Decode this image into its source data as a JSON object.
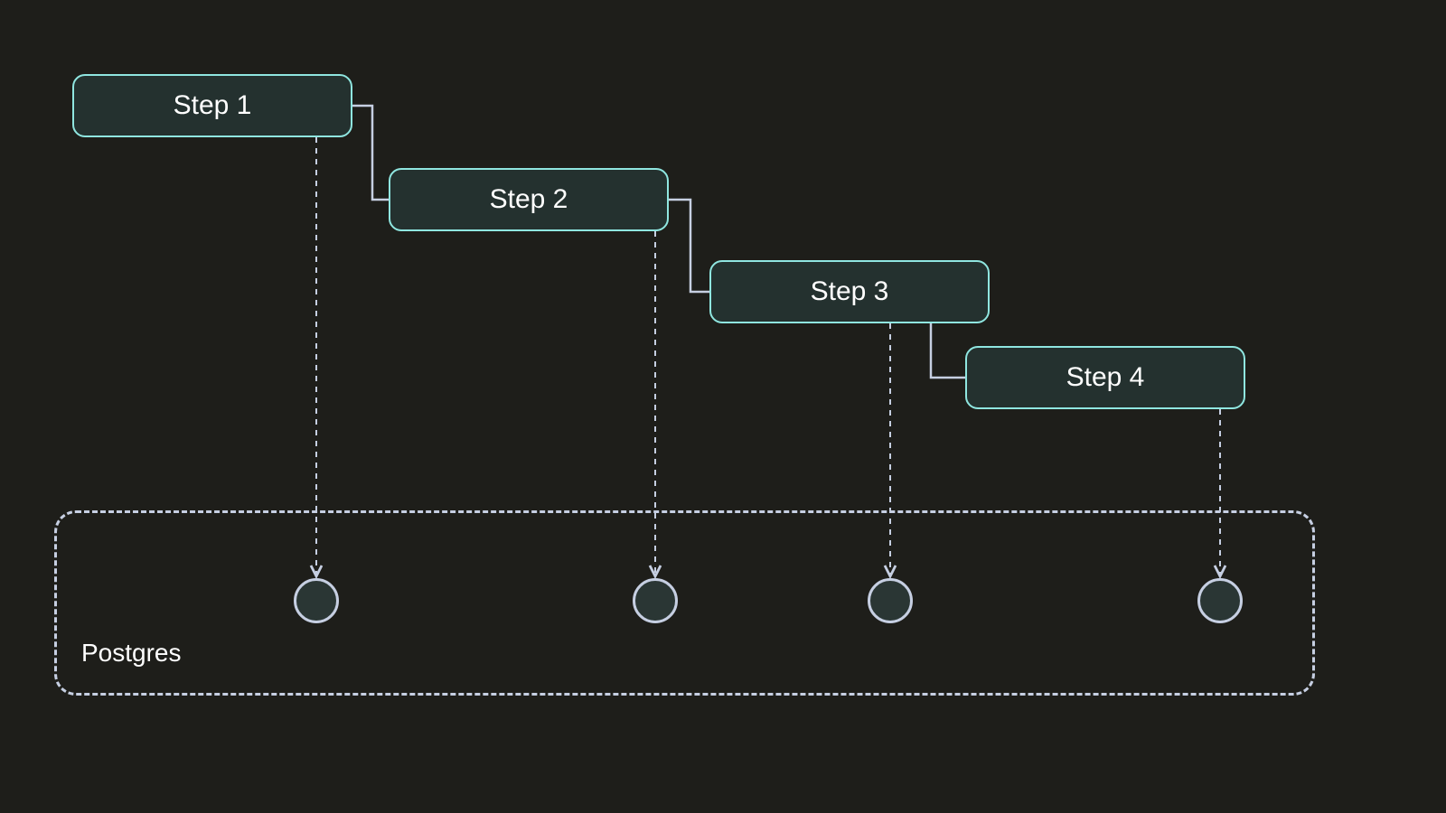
{
  "steps": [
    {
      "label": "Step 1"
    },
    {
      "label": "Step 2"
    },
    {
      "label": "Step 3"
    },
    {
      "label": "Step 4"
    }
  ],
  "database": {
    "label": "Postgres"
  },
  "colors": {
    "background": "#1e1e1a",
    "stepBorder": "#8fe6e0",
    "stepFill": "#24312f",
    "connector": "#c6cfe2",
    "dashed": "#c6cfe2",
    "nodeFill": "#2a3634"
  }
}
